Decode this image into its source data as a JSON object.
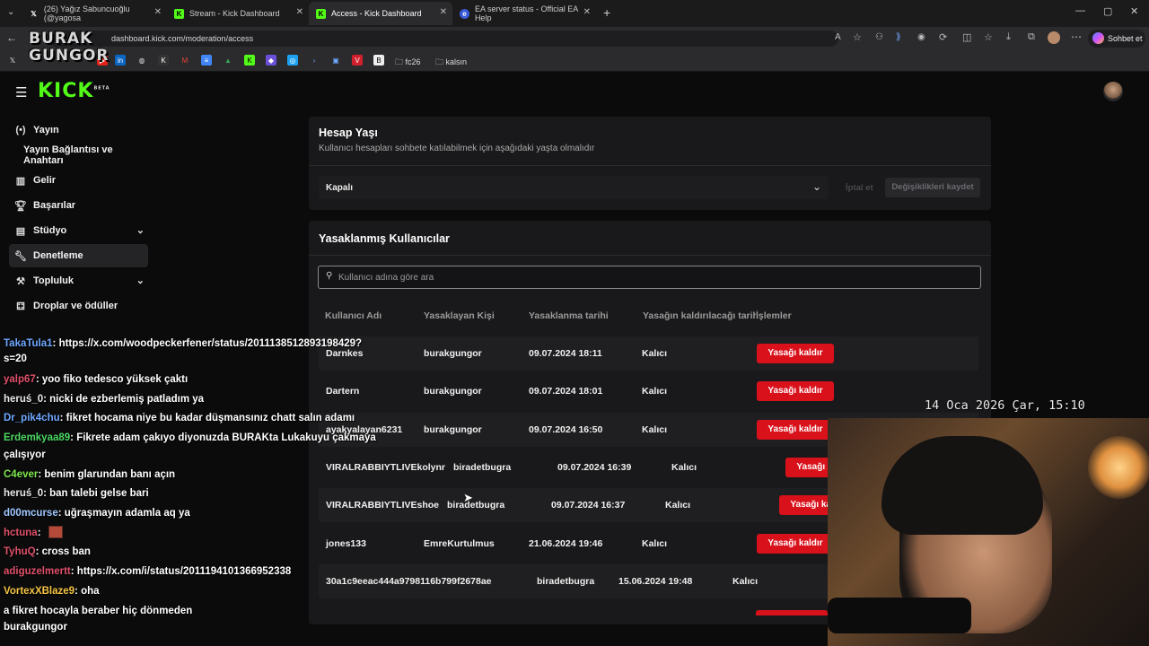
{
  "browser": {
    "tabs": [
      {
        "label": "(26) Yağız Sabuncuoğlu (@yagosa",
        "icon": "x-logo-icon"
      },
      {
        "label": "Stream - Kick Dashboard",
        "icon": "kick-logo-icon"
      },
      {
        "label": "Access - Kick Dashboard",
        "icon": "kick-logo-icon"
      },
      {
        "label": "EA server status - Official EA Help",
        "icon": "ea-logo-icon"
      }
    ],
    "url": "dashboard.kick.com/moderation/access",
    "copilot_label": "Sohbet et",
    "bookmark_folders": [
      "fc26",
      "kalsın"
    ]
  },
  "overlay": {
    "watermark_line1": "BURAK",
    "watermark_line2": "GUNGOR",
    "clock": "14 Oca 2026 Çar, 15:10"
  },
  "sidebar": {
    "items": [
      {
        "label": "Yayın",
        "icon": "broadcast-icon"
      },
      {
        "label": "Yayın Bağlantısı ve Anahtarı",
        "icon": ""
      },
      {
        "label": "Gelir",
        "icon": "chart-icon"
      },
      {
        "label": "Başarılar",
        "icon": "trophy-icon"
      },
      {
        "label": "Stüdyo",
        "icon": "studio-icon"
      },
      {
        "label": "Denetleme",
        "icon": "wrench-icon"
      },
      {
        "label": "Topluluk",
        "icon": "community-icon"
      },
      {
        "label": "Droplar ve ödüller",
        "icon": "gift-icon"
      }
    ]
  },
  "account_age": {
    "title": "Hesap Yaşı",
    "subtitle": "Kullanıcı hesapları sohbete katılabilmek için aşağıdaki yaşta olmalıdır",
    "selected": "Kapalı",
    "cancel_label": "İptal et",
    "save_label": "Değişiklikleri kaydet"
  },
  "banned": {
    "title": "Yasaklanmış Kullanıcılar",
    "search_placeholder": "Kullanıcı adına göre ara",
    "columns": [
      "Kullanıcı Adı",
      "Yasaklayan Kişi",
      "Yasaklanma tarihi",
      "Yasağın kaldırılacağı tarih",
      "İşlemler"
    ],
    "unban_label": "Yasağı kaldır",
    "rows": [
      {
        "user": "Darnkes",
        "by": "burakgungor",
        "date": "09.07.2024 18:11",
        "until": "Kalıcı"
      },
      {
        "user": "Dartern",
        "by": "burakgungor",
        "date": "09.07.2024 18:01",
        "until": "Kalıcı"
      },
      {
        "user": "ayakyalayan6231",
        "by": "burakgungor",
        "date": "09.07.2024 16:50",
        "until": "Kalıcı"
      },
      {
        "user": "VIRALRABBIYTLIVEkolynr",
        "by": "biradetbugra",
        "date": "09.07.2024 16:39",
        "until": "Kalıcı"
      },
      {
        "user": "VIRALRABBIYTLIVEshoe",
        "by": "biradetbugra",
        "date": "09.07.2024 16:37",
        "until": "Kalıcı"
      },
      {
        "user": "jones133",
        "by": "EmreKurtulmus",
        "date": "21.06.2024 19:46",
        "until": "Kalıcı"
      },
      {
        "user": "30a1c9eeac444a9798116b799f2678ae",
        "by": "biradetbugra",
        "date": "15.06.2024 19:48",
        "until": "Kalıcı"
      }
    ]
  },
  "chat": [
    {
      "user": "TakaTula1",
      "color": "#6fa8ff",
      "text": ": https://x.com/woodpeckerfener/status/2011138512893198429?"
    },
    {
      "user": "",
      "color": "#ffffff",
      "text": "s=20"
    },
    {
      "user": "yalp67",
      "color": "#e0506a",
      "text": ": yoo fiko tedesco yüksek çaktı"
    },
    {
      "user": "heruś_0",
      "color": "#e8e8e8",
      "text": ": nicki de ezberlemiş patladım ya"
    },
    {
      "user": "Dr_pik4chu",
      "color": "#6fa8ff",
      "text": ": fikret hocama niye bu kadar düşmansınız chatt salın adamı"
    },
    {
      "user": "Erdemkyaa89",
      "color": "#4cd964",
      "text": ": Fikrete adam çakıyo diyonuzda BURAKta Lukakuyu çakmaya"
    },
    {
      "user": "",
      "color": "#ffffff",
      "text": "çalışıyor"
    },
    {
      "user": "C4ever",
      "color": "#7ee84f",
      "text": ": benim glarundan banı açın"
    },
    {
      "user": "heruś_0",
      "color": "#e8e8e8",
      "text": ": ban talebi gelse bari"
    },
    {
      "user": "d00mcurse",
      "color": "#9fc8ff",
      "text": ": uğraşmayın adamla aq ya"
    },
    {
      "user": "hctuna",
      "color": "#e0506a",
      "text": ":"
    },
    {
      "user": "TyhuQ",
      "color": "#e0506a",
      "text": ": cross ban"
    },
    {
      "user": "adiguzelmertt",
      "color": "#e0506a",
      "text": ": https://x.com/i/status/2011194101366952338"
    },
    {
      "user": "VortexXBlaze9",
      "color": "#f5c542",
      "text": ": oha"
    },
    {
      "user": "",
      "color": "#ffffff",
      "text": "a fikret hocayla beraber hiç dönmeden"
    },
    {
      "user": "",
      "color": "#ffffff",
      "text": "burakgungor"
    }
  ]
}
